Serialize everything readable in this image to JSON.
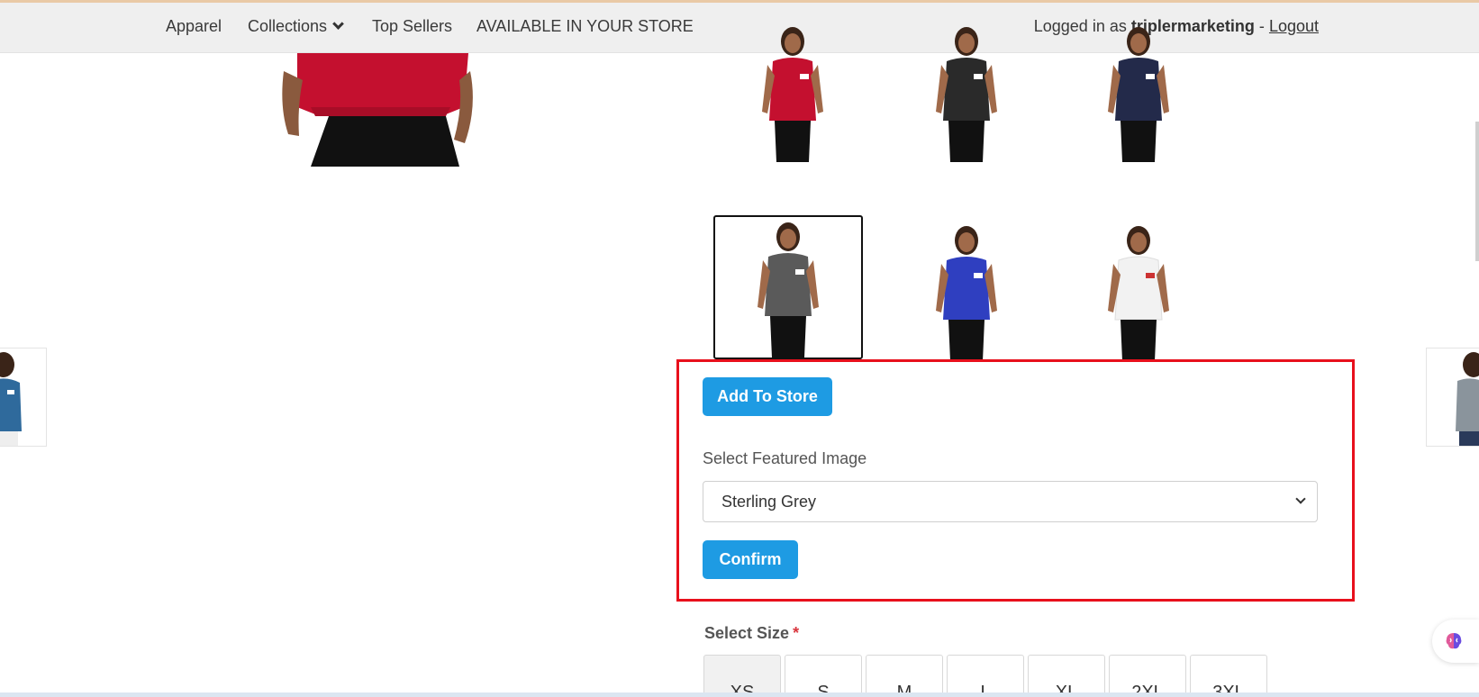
{
  "nav": {
    "apparel": "Apparel",
    "collections": "Collections",
    "top_sellers": "Top Sellers",
    "available": "AVAILABLE IN YOUR STORE",
    "logged_in_prefix": "Logged in as",
    "username": "triplermarketing",
    "separator": "-",
    "logout": "Logout"
  },
  "thumbnails": [
    {
      "color": "#c4102f",
      "name": "red"
    },
    {
      "color": "#2a2a2a",
      "name": "black"
    },
    {
      "color": "#232a4a",
      "name": "navy"
    },
    {
      "color": "#5a5a5a",
      "name": "sterling-grey"
    },
    {
      "color": "#2f3fc0",
      "name": "royal-blue"
    },
    {
      "color": "#f2f2f2",
      "name": "white"
    }
  ],
  "actions": {
    "add_to_store": "Add To Store",
    "featured_label": "Select Featured Image",
    "featured_value": "Sterling Grey",
    "confirm": "Confirm"
  },
  "size": {
    "label": "Select Size",
    "required_mark": "*",
    "options": [
      "XS",
      "S",
      "M",
      "L",
      "XL",
      "2XL",
      "3XL"
    ]
  }
}
